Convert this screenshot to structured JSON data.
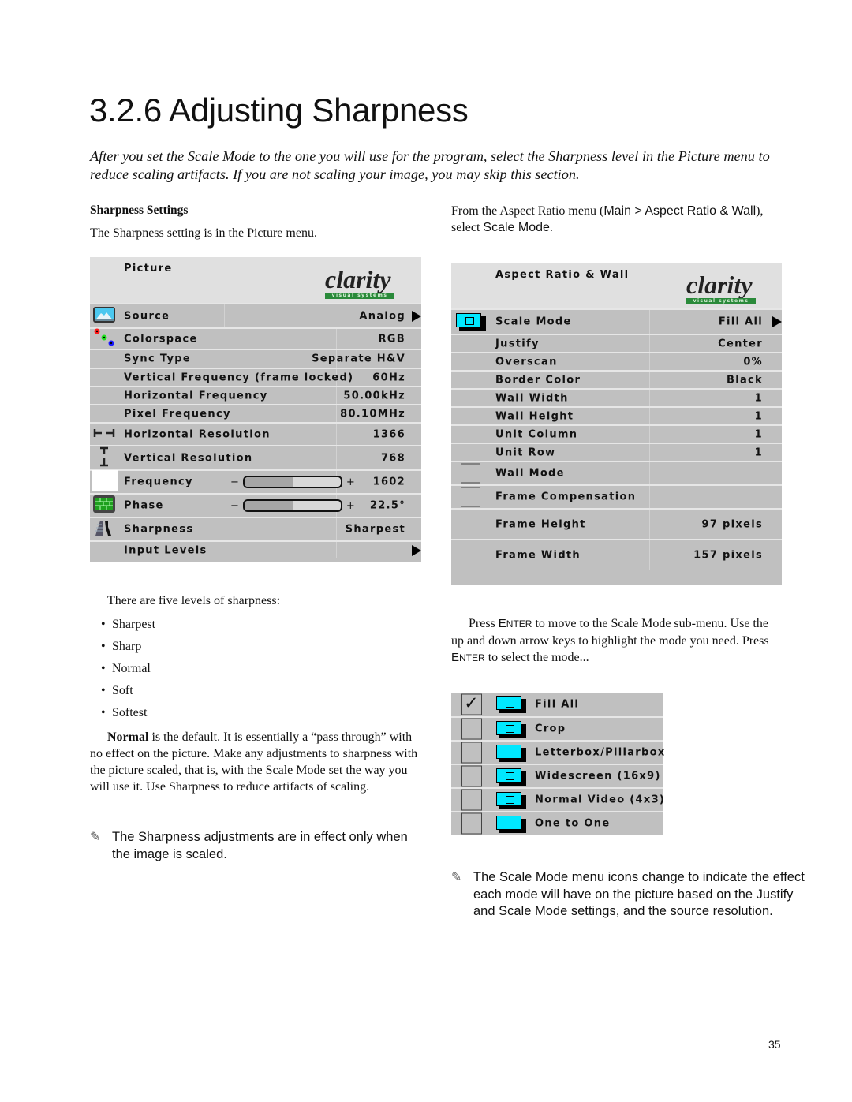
{
  "page": {
    "title": "3.2.6  Adjusting Sharpness",
    "intro": "After you set the Scale Mode to the one you will use for the program, select the Sharpness level in the Picture menu to reduce scaling artifacts. If you are not scaling your image, you may skip this section.",
    "page_number": "35"
  },
  "left": {
    "heading": "Sharpness Settings",
    "lead": "The Sharpness setting is in the Picture menu.",
    "levels_intro": "There are five levels of sharpness:",
    "levels": [
      "Sharpest",
      "Sharp",
      "Normal",
      "Soft",
      "Softest"
    ],
    "normal_bold": "Normal",
    "normal_text": " is the default. It is essentially a “pass through” with no effect on the picture. Make any adjustments to sharpness with the picture scaled, that is, with the Scale Mode set the way you will use it. Use Sharpness to reduce artifacts of scaling.",
    "note_icon": "pencil-icon",
    "note": "The Sharpness adjustments are in effect only when the image is scaled."
  },
  "picture_menu": {
    "title": "Picture",
    "logo_word": "clarity",
    "logo_sub": "visual systems",
    "rows": [
      {
        "label": "Source",
        "value": "Analog",
        "icon": "mountain-photo-icon",
        "submenu": true
      },
      {
        "label": "Colorspace",
        "value": "RGB",
        "icon": "rgb-dots-icon"
      },
      {
        "label": "Sync Type",
        "value": "Separate H&V"
      },
      {
        "label": "Vertical Frequency (frame locked)",
        "value": "60Hz"
      },
      {
        "label": "Horizontal Frequency",
        "value": "50.00kHz"
      },
      {
        "label": "Pixel Frequency",
        "value": "80.10MHz"
      },
      {
        "label": "Horizontal Resolution",
        "value": "1366",
        "icon": "horizontal-resolution-icon"
      },
      {
        "label": "Vertical Resolution",
        "value": "768",
        "icon": "vertical-resolution-icon"
      },
      {
        "label": "Frequency",
        "value": "1602",
        "icon": "white-square-icon",
        "slider_fraction": 0.5
      },
      {
        "label": "Phase",
        "value": "22.5°",
        "icon": "green-grid-icon",
        "slider_fraction": 0.5
      },
      {
        "label": "Sharpness",
        "value": "Sharpest",
        "icon": "sharpness-icon"
      },
      {
        "label": "Input Levels",
        "value": "",
        "submenu": true
      }
    ],
    "slider_minus": "−",
    "slider_plus": "+"
  },
  "right": {
    "intro_a": "From the Aspect Ratio menu (",
    "intro_path": "Main > Aspect Ratio & Wall",
    "intro_b": "), select ",
    "intro_item": "Scale Mode",
    "intro_c": ".",
    "press_1": "Press ",
    "enter_key": "ENTER",
    "press_2": " to move to the Scale Mode sub-menu. Use the up and down arrow keys to highlight the mode you need. Press ",
    "press_3": " to select the mode...",
    "note_icon": "pencil-icon",
    "note": "The Scale Mode menu icons change to indicate the effect each mode will have on the picture based on the Justify and Scale Mode settings, and the source resolution."
  },
  "aspect_menu": {
    "title": "Aspect Ratio & Wall",
    "logo_word": "clarity",
    "logo_sub": "visual systems",
    "rows": [
      {
        "label": "Scale Mode",
        "value": "Fill All",
        "icon": "scale-mode-icon",
        "submenu": true
      },
      {
        "label": "Justify",
        "value": "Center"
      },
      {
        "label": "Overscan",
        "value": "0%"
      },
      {
        "label": "Border Color",
        "value": "Black"
      },
      {
        "label": "Wall Width",
        "value": "1"
      },
      {
        "label": "Wall Height",
        "value": "1"
      },
      {
        "label": "Unit Column",
        "value": "1"
      },
      {
        "label": "Unit Row",
        "value": "1"
      },
      {
        "label": "Wall Mode",
        "value": "",
        "checkbox": true,
        "checked": false
      },
      {
        "label": "Frame Compensation",
        "value": "",
        "checkbox": true,
        "checked": false
      },
      {
        "label": "Frame Height",
        "value": "97 pixels"
      },
      {
        "label": "Frame Width",
        "value": "157 pixels"
      }
    ]
  },
  "scale_submenu": {
    "options": [
      {
        "label": "Fill All",
        "checked": true
      },
      {
        "label": "Crop",
        "checked": false
      },
      {
        "label": "Letterbox/Pillarbox",
        "checked": false
      },
      {
        "label": "Widescreen (16x9)",
        "checked": false
      },
      {
        "label": "Normal Video (4x3)",
        "checked": false
      },
      {
        "label": "One to One",
        "checked": false
      }
    ],
    "check_glyph": "✓"
  },
  "colors": {
    "menu_bg": "#c0c0c0",
    "menu_header_bg": "#e0e0e0",
    "icon_cyan": "#00e8ff",
    "logo_green": "#2a8a3a"
  }
}
